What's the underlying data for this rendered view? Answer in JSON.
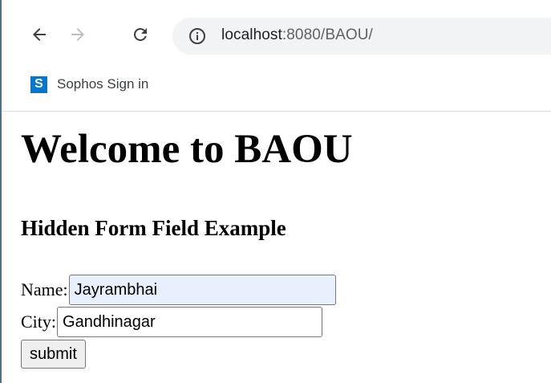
{
  "browser": {
    "url_host": "localhost",
    "url_rest": ":8080/BAOU/",
    "nav": {
      "back_icon": "arrow-left-icon",
      "forward_icon": "arrow-right-icon",
      "reload_icon": "reload-icon",
      "info_icon": "info-icon"
    }
  },
  "bookmarks": [
    {
      "icon_letter": "S",
      "label": "Sophos Sign in",
      "icon_color": "#0a76c7"
    }
  ],
  "page": {
    "title": "Welcome to BAOU",
    "subtitle": "Hidden Form Field Example",
    "form": {
      "name_label": "Name:",
      "name_value": "Jayrambhai",
      "city_label": "City:",
      "city_value": "Gandhinagar",
      "submit_label": "submit"
    }
  },
  "colors": {
    "autofill_bg": "#e8f0fe",
    "omnibox_bg": "#f1f3f4",
    "window_border": "#4a6f8f"
  }
}
